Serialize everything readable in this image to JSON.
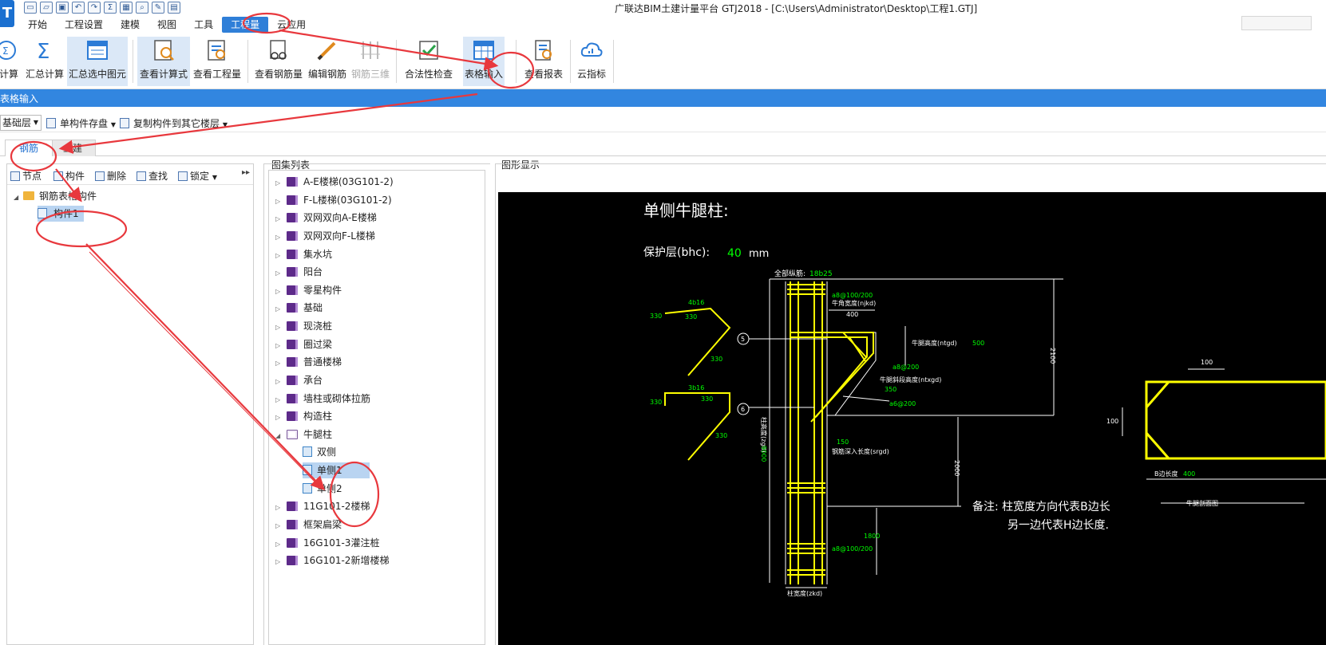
{
  "window": {
    "title": "广联达BIM土建计量平台 GTJ2018 - [C:\\Users\\Administrator\\Desktop\\工程1.GTJ]",
    "logo": "T"
  },
  "quick_access": [
    "new-file-icon",
    "open-folder-icon",
    "save-icon",
    "undo-icon",
    "redo-icon",
    "sum-icon",
    "table-icon",
    "search-table-icon",
    "edit-pencil-icon",
    "table-input-icon"
  ],
  "menu": {
    "items": [
      "开始",
      "工程设置",
      "建模",
      "视图",
      "工具",
      "工程量",
      "云应用"
    ],
    "active_index": 5
  },
  "ribbon": {
    "buttons": [
      {
        "label": "计算",
        "icon": "calculate-icon"
      },
      {
        "label": "汇总计算",
        "icon": "sigma-icon"
      },
      {
        "label": "汇总选中图元",
        "icon": "summary-selected-icon"
      },
      {
        "label": "查看计算式",
        "icon": "view-formula-icon"
      },
      {
        "label": "查看工程量",
        "icon": "view-quantity-icon"
      },
      {
        "label": "查看钢筋量",
        "icon": "view-rebar-icon"
      },
      {
        "label": "编辑钢筋",
        "icon": "edit-rebar-icon"
      },
      {
        "label": "钢筋三维",
        "icon": "rebar-3d-icon"
      },
      {
        "label": "合法性检查",
        "icon": "validity-check-icon"
      },
      {
        "label": "表格输入",
        "icon": "table-input-icon"
      },
      {
        "label": "查看报表",
        "icon": "view-report-icon"
      },
      {
        "label": "云指标",
        "icon": "cloud-index-icon"
      }
    ]
  },
  "panel": {
    "title": "表格输入"
  },
  "toolbar": {
    "floor": "基础层",
    "save_component": "单构件存盘",
    "copy_to_floor": "复制构件到其它楼层"
  },
  "tabs": [
    "钢筋",
    "土建"
  ],
  "tree_toolbar": [
    "节点",
    "构件",
    "删除",
    "查找",
    "锁定"
  ],
  "tree": {
    "root": "钢筋表格构件",
    "children": [
      "构件1"
    ]
  },
  "list": {
    "title": "图集列表",
    "items": [
      "A-E楼梯(03G101-2)",
      "F-L楼梯(03G101-2)",
      "双网双向A-E楼梯",
      "双网双向F-L楼梯",
      "集水坑",
      "阳台",
      "零星构件",
      "基础",
      "现浇桩",
      "圈过梁",
      "普通楼梯",
      "承台",
      "墙柱或砌体拉筋",
      "构造柱",
      "牛腿柱"
    ],
    "expanded_children": [
      "双侧",
      "单侧1",
      "单侧2"
    ],
    "after_items": [
      "11G101-2楼梯",
      "框架扁梁",
      "16G101-3灌注桩",
      "16G101-2新增楼梯"
    ]
  },
  "graphic": {
    "title": "图形显示",
    "drawing_title": "单侧牛腿柱:",
    "cover_label": "保护层(bhc):",
    "cover_value": "40",
    "cover_unit": "mm",
    "note_line1": "备注: 柱宽度方向代表B边长",
    "note_line2": "另一边代表H边长度.",
    "labels": {
      "all_long_rebar": "全部纵筋:",
      "all_long_rebar_val": "18b25",
      "stirrup_top": "a8@100/200",
      "corbel_width": "牛角宽度(njkd)",
      "corbel_width_val": "400",
      "corbel_height": "牛腿高度(ntgd)",
      "corbel_height_val": "500",
      "dim_2100": "2100",
      "stirrup_mid": "a8@200",
      "slope_height": "牛腿斜段高度(ntxgd)",
      "slope_height_val": "350",
      "stirrup_low": "a6@200",
      "anchor_len": "钢筋深入长度(srgd)",
      "anchor_val": "150",
      "dim_2000": "2000",
      "dim_1800": "1800",
      "stirrup_bottom": "a8@100/200",
      "col_height": "柱高度(zgd)",
      "col_height_val": "9000",
      "col_width": "柱宽度(zkd)",
      "circle5": "5",
      "circle6": "6",
      "bar_4b16": "4b16",
      "bar_3b16": "3b16",
      "d330": "330",
      "d100_top": "100",
      "d100_side": "100",
      "b_len": "B边长度",
      "b_len_val": "400",
      "section": "牛腿剖面图"
    }
  },
  "colors": {
    "accent": "#3286e0",
    "annotation": "#e8383d",
    "rebar": "#ffff00",
    "dim_green": "#00ff00"
  }
}
